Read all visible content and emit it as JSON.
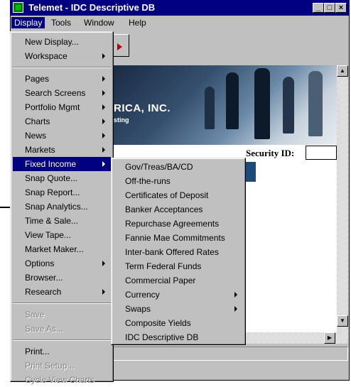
{
  "window": {
    "title": "Telemet - IDC Descriptive DB",
    "controls": {
      "minimize": "_",
      "maximize": "□",
      "close": "×"
    }
  },
  "menubar": [
    "Display",
    "Tools",
    "Window",
    "Help"
  ],
  "banner": {
    "text": "RICA, INC.",
    "subtext": "sting"
  },
  "security": {
    "label": "Security ID:",
    "value": ""
  },
  "display_menu": {
    "group1": [
      "New Display...",
      "Workspace"
    ],
    "group2": [
      "Pages",
      "Search Screens",
      "Portfolio Mgmt",
      "Charts",
      "News",
      "Markets",
      "Fixed Income",
      "Snap Quote...",
      "Snap Report...",
      "Snap Analytics...",
      "Time & Sale...",
      "View Tape...",
      "Market Maker...",
      "Options",
      "Browser...",
      "Research"
    ],
    "group3": [
      "Save",
      "Save As..."
    ],
    "group4": [
      "Print...",
      "Print Setup...",
      "Cycle View Charts"
    ]
  },
  "fixed_income_menu": [
    "Gov/Treas/BA/CD",
    "Off-the-runs",
    "Certificates of Deposit",
    "Banker Acceptances",
    "Repurchase Agreements",
    "Fannie Mae Commitments",
    "Inter-bank Offered Rates",
    "Term Federal Funds",
    "Commercial Paper",
    "Currency",
    "Swaps",
    "Composite Yields",
    "IDC Descriptive DB"
  ],
  "colors": {
    "title_bar": "#000080",
    "highlight": "#000080",
    "menu_bg": "#c0c0c0"
  },
  "icons": [
    "app-icon",
    "submenu-arrow-icon",
    "scroll-up-icon",
    "scroll-down-icon",
    "scroll-right-icon",
    "callout-arrow-icon"
  ]
}
